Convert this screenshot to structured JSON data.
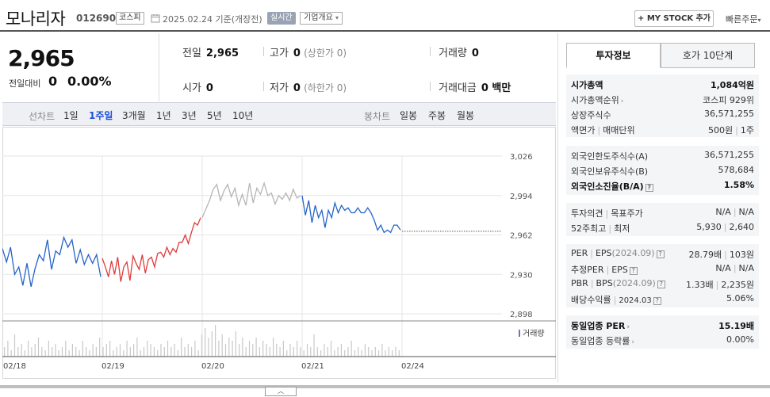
{
  "header": {
    "company_name": "모나리자",
    "stock_code": "012690",
    "market": "코스피",
    "date_text": "2025.02.24 기준(개장전)",
    "realtime_label": "실시간",
    "overview_label": "기업개요",
    "mystock_label": "+ MY STOCK 추가",
    "quickorder_label": "빠른주문"
  },
  "price": {
    "current": "2,965",
    "change_label": "전일대비",
    "change_value": "0",
    "change_pct": "0.00%"
  },
  "quote": {
    "prev_close_label": "전일",
    "prev_close": "2,965",
    "high_label": "고가",
    "high": "0",
    "high_limit": "(상한가 0)",
    "volume_label": "거래량",
    "volume": "0",
    "open_label": "시가",
    "open": "0",
    "low_label": "저가",
    "low": "0",
    "low_limit": "(하한가 0)",
    "amount_label": "거래대금",
    "amount": "0 백만"
  },
  "periods": {
    "line_label": "선차트",
    "line_tabs": [
      "1일",
      "1주일",
      "3개월",
      "1년",
      "3년",
      "5년",
      "10년"
    ],
    "active": "1주일",
    "candle_label": "봉차트",
    "candle_tabs": [
      "일봉",
      "주봉",
      "월봉"
    ]
  },
  "chart_data": {
    "type": "line",
    "x_labels": [
      "02/18",
      "02/19",
      "02/20",
      "02/21",
      "02/24"
    ],
    "y_ticks": [
      3026,
      2994,
      2962,
      2930,
      2898
    ],
    "ylim": [
      2898,
      3026
    ],
    "reference_price": 2965,
    "volume_legend": "거래량",
    "colors": {
      "down": "#2563c9",
      "up": "#e03a3a",
      "neutral": "#b5b5b5",
      "grid": "#e6e6e6",
      "volume": "#c9c9c9"
    },
    "series": [
      {
        "segment": "02/18",
        "color": "down",
        "values": [
          2951,
          2940,
          2952,
          2930,
          2936,
          2921,
          2939,
          2920,
          2935,
          2946,
          2941,
          2958,
          2934,
          2949,
          2946,
          2960,
          2952,
          2958,
          2939,
          2950,
          2938,
          2946,
          2939,
          2946,
          2928
        ]
      },
      {
        "segment": "02/19",
        "color": "up",
        "values": [
          2943,
          2936,
          2928,
          2941,
          2930,
          2944,
          2924,
          2936,
          2940,
          2925,
          2945,
          2939,
          2934,
          2946,
          2931,
          2942,
          2944,
          2936,
          2947,
          2948,
          2944,
          2952,
          2946,
          2951,
          2948,
          2956,
          2956,
          2962,
          2955,
          2964,
          2972,
          2970,
          2976
        ]
      },
      {
        "segment": "02/20",
        "color": "neutral",
        "values": [
          2976,
          2983,
          2990,
          2999,
          3003,
          2990,
          2998,
          3003,
          2993,
          3000,
          2986,
          2995,
          2986,
          3004,
          2988,
          3000,
          2995,
          3004,
          2994,
          2996,
          2987,
          2994,
          2991,
          2996,
          2990,
          2999,
          2992,
          2994
        ]
      },
      {
        "segment": "02/21",
        "color": "down",
        "values": [
          2994,
          2978,
          2990,
          2972,
          2986,
          2976,
          2982,
          2968,
          2982,
          2976,
          2988,
          2980,
          2986,
          2982,
          2984,
          2980,
          2980,
          2984,
          2980,
          2980,
          2984,
          2980,
          2974,
          2966,
          2970,
          2964,
          2966,
          2964,
          2970,
          2970,
          2966
        ]
      }
    ],
    "volume": [
      0.3,
      0.5,
      0.2,
      0.7,
      0.3,
      0.4,
      0.2,
      0.5,
      0.3,
      0.4,
      0.6,
      0.3,
      0.2,
      0.5,
      0.3,
      0.4,
      0.2,
      0.3,
      0.5,
      0.2,
      0.4,
      0.3,
      0.2,
      0.5,
      0.3,
      0.2,
      0.4,
      0.3,
      0.6,
      0.3,
      0.4,
      0.5,
      0.2,
      0.3,
      0.4,
      0.2,
      0.5,
      0.3,
      0.4,
      0.6,
      0.2,
      0.3,
      0.5,
      0.4,
      0.3,
      0.2,
      0.4,
      0.3,
      0.5,
      0.3,
      0.4,
      0.2,
      0.6,
      0.3,
      0.4,
      0.3,
      0.5,
      0.2,
      0.7,
      0.9,
      0.6,
      0.8,
      1.0,
      0.5,
      0.7,
      0.4,
      0.6,
      0.5,
      0.8,
      0.4,
      0.6,
      0.3,
      0.5,
      0.4,
      0.6,
      0.3,
      0.5,
      0.4,
      0.3,
      0.6,
      0.4,
      0.3,
      0.5,
      0.2,
      0.4,
      0.3,
      0.5,
      0.3,
      0.2,
      0.4,
      0.3,
      0.7,
      0.3,
      0.2,
      0.4,
      0.3,
      0.5,
      0.2,
      0.3,
      0.4,
      0.2,
      0.3,
      0.5,
      0.2,
      0.3,
      0.2,
      0.4,
      0.3,
      0.2,
      0.3,
      0.2,
      0.4,
      0.2,
      0.3,
      0.2,
      0.3,
      0.2
    ]
  },
  "side": {
    "tab_info": "투자정보",
    "tab_orderbook": "호가 10단계",
    "market_cap_label": "시가총액",
    "market_cap": "1,084억원",
    "market_cap_rank_label": "시가총액순위",
    "market_cap_rank": "코스피 929위",
    "listed_shares_label": "상장주식수",
    "listed_shares": "36,571,255",
    "face_value_label": "액면가",
    "trade_unit_label": "매매단위",
    "face_value": "500원",
    "trade_unit": "1주",
    "foreign_limit_label": "외국인한도주식수(A)",
    "foreign_limit": "36,571,255",
    "foreign_hold_label": "외국인보유주식수(B)",
    "foreign_hold": "578,684",
    "foreign_ratio_label": "외국인소진율(B/A)",
    "foreign_ratio": "1.58%",
    "opinion_label": "투자의견",
    "target_label": "목표주가",
    "opinion": "N/A",
    "target": "N/A",
    "week52_high_label": "52주최고",
    "week52_low_label": "최저",
    "week52_high": "5,930",
    "week52_low": "2,640",
    "per_label": "PER",
    "eps_label": "EPS",
    "eps_period": "(2024.09)",
    "per": "28.79배",
    "eps": "103원",
    "est_per_label": "추정PER",
    "est_eps_label": "EPS",
    "est_per": "N/A",
    "est_eps": "N/A",
    "pbr_label": "PBR",
    "bps_label": "BPS",
    "bps_period": "(2024.09)",
    "pbr": "1.33배",
    "bps": "2,235원",
    "dividend_label": "배당수익률",
    "dividend_period": "2024.03",
    "dividend": "5.06%",
    "sector_per_label": "동일업종 PER",
    "sector_per": "15.19배",
    "sector_change_label": "동일업종 등락률",
    "sector_change": "0.00%"
  },
  "collapse_icon": "chevron-up-icon"
}
